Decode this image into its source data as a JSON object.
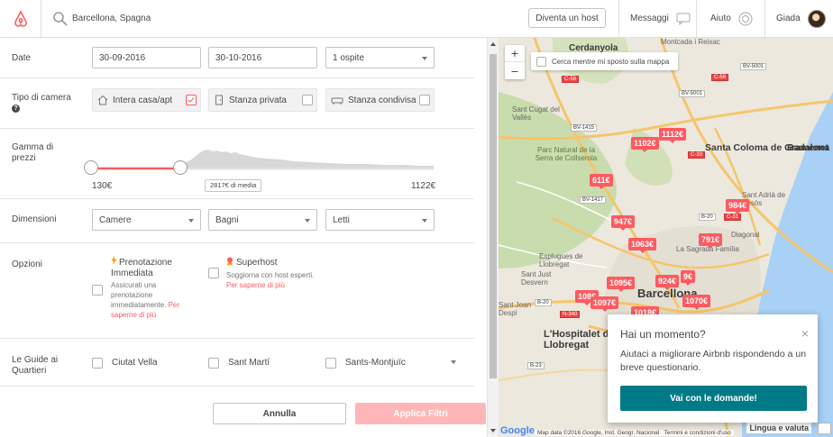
{
  "header": {
    "search_value": "Barcellona, Spagna",
    "host_button": "Diventa un host",
    "messages": "Messaggi",
    "help": "Aiuto",
    "user": "Giada"
  },
  "filters": {
    "dates": {
      "label": "Date",
      "checkin": "30-09-2016",
      "checkout": "30-10-2016",
      "guests": "1 ospite"
    },
    "room_type": {
      "label": "Tipo di camera",
      "options": [
        {
          "label": "Intera casa/apt",
          "checked": true
        },
        {
          "label": "Stanza privata",
          "checked": false
        },
        {
          "label": "Stanza condivisa",
          "checked": false
        }
      ]
    },
    "price": {
      "label": "Gamma di prezzi",
      "min": "130€",
      "max": "1122€",
      "average": "2817€ di media"
    },
    "size": {
      "label": "Dimensioni",
      "rooms": "Camere",
      "bathrooms": "Bagni",
      "beds": "Letti"
    },
    "options": {
      "label": "Opzioni",
      "instant_title": "Prenotazione Immediata",
      "instant_desc": "Assicurati una prenotazione immediatamente.",
      "instant_link": "Per saperne di più",
      "superhost_title": "Superhost",
      "superhost_desc": "Soggiorna con host esperti.",
      "superhost_link": "Per saperne di più"
    },
    "guides": {
      "label": "Le Guide ai Quartieri",
      "items": [
        "Ciutat Vella",
        "Sant Martí",
        "Sants-Montjuïc"
      ]
    },
    "cancel": "Annulla",
    "apply": "Applica Filtri"
  },
  "map": {
    "zoom_in": "+",
    "zoom_out": "−",
    "search_on_move": "Cerca mentre mi sposto sulla mappa",
    "pins": [
      "1112€",
      "1102€",
      "611€",
      "984€",
      "947€",
      "791€",
      "1063€",
      "1095€",
      "924€",
      "9€",
      "108€",
      "1097€",
      "1070€",
      "1018€"
    ],
    "places": [
      "Cerdanyola",
      "Sant Cugat del Vallès",
      "Santa Coloma de Gramenet",
      "Badalona",
      "Parc Natural de la Serra de Collserola",
      "Sant Adrià de Besòs",
      "La Sagrada Família",
      "Barcellona",
      "L'Hospitalet de Llobregat",
      "Esplugues de Llobregat",
      "Sant Joan Despí",
      "Sant Just Desvern",
      "Montcada i Reixac",
      "Diagonal"
    ],
    "attribution": "Map data ©2016 Google, Inst. Geogr. Nacional",
    "terms": "Termini e condizioni d'uso",
    "language": "Lingua e valuta",
    "google": "Google"
  },
  "popup": {
    "title": "Hai un momento?",
    "body": "Aiutaci a migliorare Airbnb rispondendo a un breve questionario.",
    "button": "Vai con le domande!"
  },
  "colors": {
    "brand": "#ff5a5f",
    "popup_button": "#007a87"
  }
}
